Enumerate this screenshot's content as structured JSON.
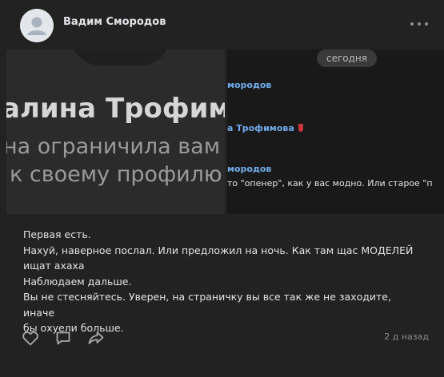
{
  "post": {
    "author": "Вадим Смородов",
    "more_icon": "more-horizontal-icon",
    "attachment_left": {
      "big_name": "алина Трофимо",
      "line1": "на ограничила вам",
      "line2": "к своему профилю"
    },
    "attachment_right": {
      "date_pill": "сегодня",
      "messages": [
        {
          "name": "мородов"
        },
        {
          "name": "а Трофимова",
          "emoji": "wine-glass-icon"
        },
        {
          "name": "мородов",
          "text": "то \"опенер\", как у вас модно. Или старое \"п"
        }
      ]
    },
    "text_lines": [
      "Первая есть.",
      "Нахуй, наверное послал. Или предложил на ночь. Как там щас МОДЕЛЕЙ",
      "ищат ахаха",
      "Наблюдаем дальше.",
      "Вы не стесняйтесь. Уверен, на страничку вы все так же не заходите, иначе",
      "бы охуели больше."
    ],
    "timestamp": "2 д назад",
    "actions": [
      "like-icon",
      "comment-icon",
      "share-icon"
    ],
    "colors": {
      "link": "#71aaeb",
      "background": "#222222"
    }
  }
}
